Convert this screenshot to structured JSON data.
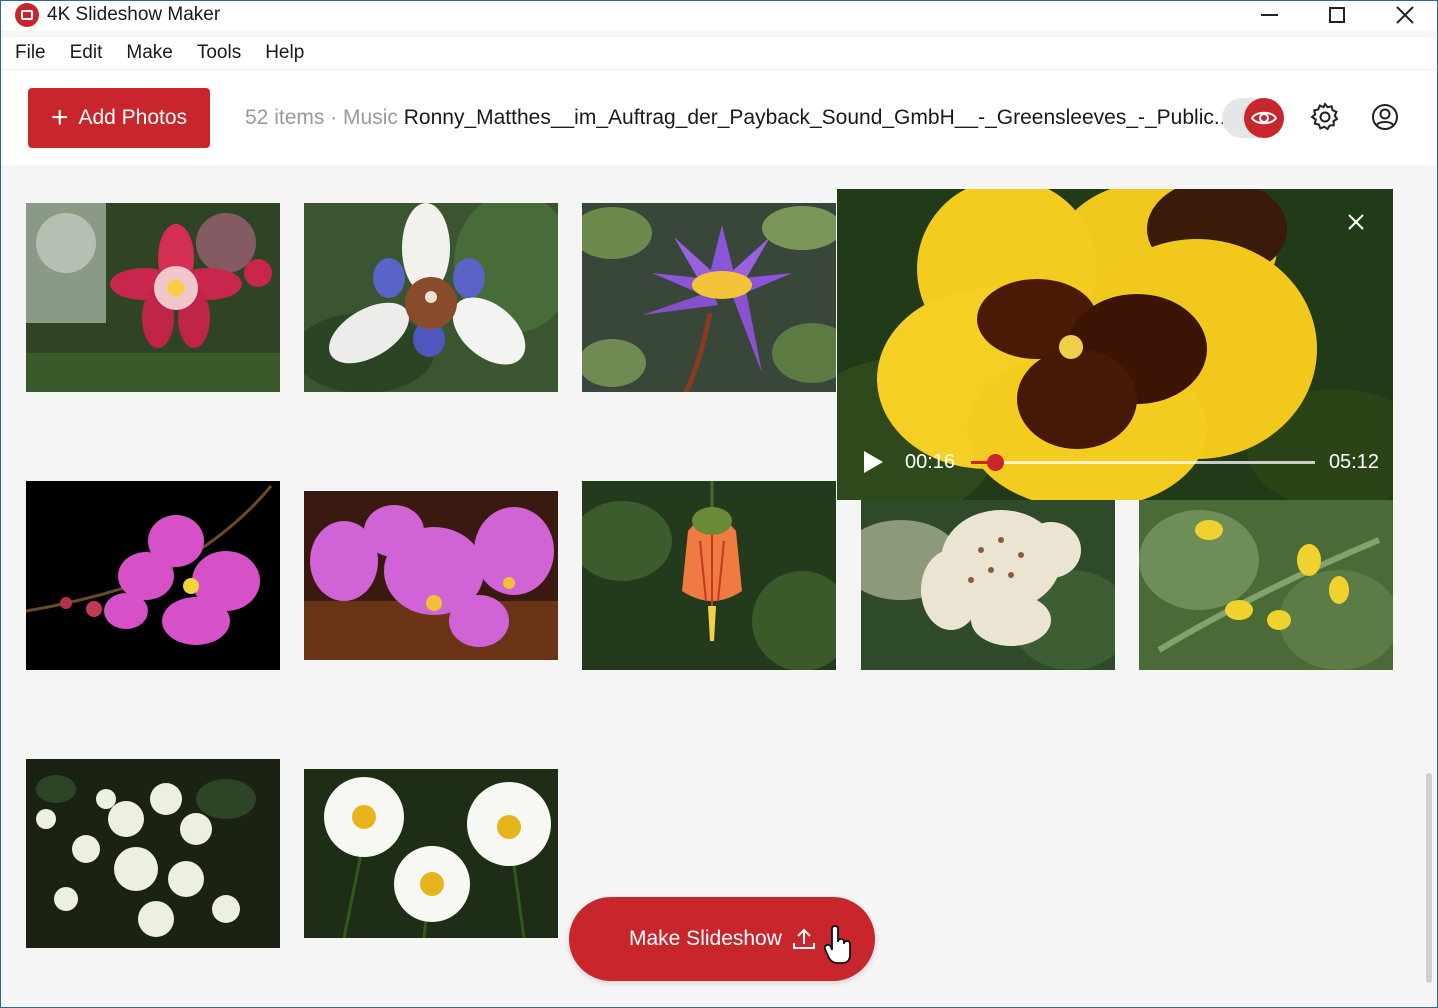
{
  "app": {
    "title": "4K Slideshow Maker"
  },
  "menu": {
    "items": [
      "File",
      "Edit",
      "Make",
      "Tools",
      "Help"
    ]
  },
  "toolbar": {
    "add_label": "Add Photos",
    "items_text": "52 items",
    "separator": " · ",
    "music_label": "Music",
    "music_track": "Ronny_Matthes__im_Auftrag_der_Payback_Sound_GmbH__-_Greensleeves_-_Public...",
    "preview_toggle_on": true
  },
  "preview": {
    "current_time": "00:16",
    "total_time": "05:12",
    "progress": 0.07
  },
  "actions": {
    "make_label": "Make Slideshow"
  },
  "colors": {
    "accent": "#c8262c",
    "background": "#f5f5f5"
  },
  "icons": [
    "app-logo-icon",
    "minimize-icon",
    "maximize-icon",
    "close-icon",
    "plus-icon",
    "eye-icon",
    "gear-icon",
    "account-icon",
    "play-icon",
    "upload-icon",
    "hand-cursor-icon"
  ]
}
